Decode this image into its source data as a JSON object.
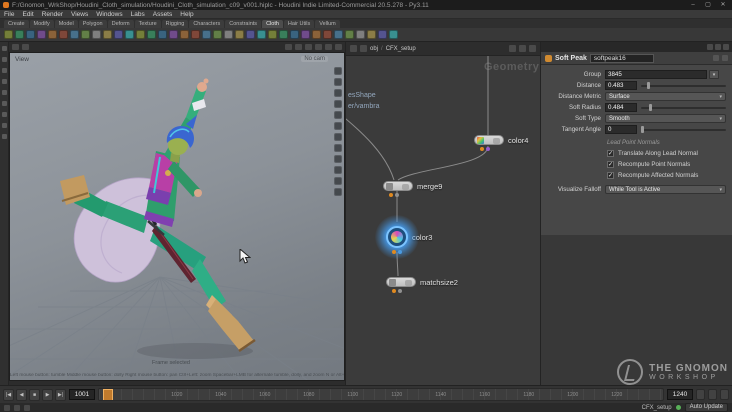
{
  "window": {
    "title": "F:/Gnomon_WrkShop/Houdini_Cloth_simulation/Houdini_Cloth_simulation_c09_v001.hiplc - Houdini Indie Limited-Commercial 20.5.278 - Py3.11",
    "minimize": "–",
    "maximize": "▢",
    "close": "✕"
  },
  "menubar": {
    "items": [
      "File",
      "Edit",
      "Render",
      "Views",
      "Windows",
      "Labs",
      "Assets",
      "Help"
    ]
  },
  "shelf": {
    "tabs": [
      "Create",
      "Modify",
      "Model",
      "Polygon",
      "Deform",
      "Texture",
      "Rigging",
      "Characters",
      "Constraints",
      "Cloth",
      "Hair Utils",
      "Vellum"
    ]
  },
  "viewport": {
    "view_label": "View",
    "camera_label": "No cam",
    "frame_hint": "Frame selected",
    "nav_help": "Left mouse button: tumble   Middle mouse button: dolly   Right mouse button: pan   Ctrl+Left: zoom   Spacebar+LMB for alternate tumble, dolly, and zoom   N or Alt+M for First Person Navigation"
  },
  "network": {
    "path_root": "obj",
    "path_current": "CFX_setup",
    "context_label": "Geometry",
    "clipped_label_1": "esShape",
    "clipped_label_2": "er/vambra",
    "nodes": {
      "n1": "color4",
      "n2": "merge9",
      "n3": "color3",
      "n4": "matchsize2"
    }
  },
  "params": {
    "node_type": "Soft Peak",
    "node_name": "softpeak16",
    "check_glyph": "✓",
    "rows": [
      {
        "label": "Group",
        "value": "3845"
      },
      {
        "label": "Distance",
        "value": "0.483"
      },
      {
        "label": "Distance Metric",
        "value": "Surface"
      },
      {
        "label": "Soft Radius",
        "value": "0.484"
      },
      {
        "label": "Soft Type",
        "value": "Smooth"
      },
      {
        "label": "Tangent Angle",
        "value": "0"
      },
      {
        "label": "Lead Point Normals"
      },
      {
        "label": "Translate Along Lead Normal"
      },
      {
        "label": "Recompute Point Normals"
      },
      {
        "label": "Recompute Affected Normals"
      },
      {
        "label": "Visualize Falloff",
        "value": "While Tool is Active"
      }
    ]
  },
  "timeline": {
    "transport": [
      "|◀",
      "◀",
      "■",
      "▶",
      "▶|"
    ],
    "current_frame": "1001",
    "end_frame": "1240",
    "tick_labels": [
      "1020",
      "1040",
      "1060",
      "1080",
      "1100",
      "1120",
      "1140",
      "1160",
      "1180",
      "1200",
      "1220"
    ]
  },
  "statusbar": {
    "auto_update": "Auto Update",
    "context": "CFX_setup"
  },
  "watermark": {
    "line1": "THE GNOMON",
    "line2": "WORKSHOP"
  },
  "colors": {
    "accent_orange": "#d8862a",
    "select_blue": "#46a0f5"
  },
  "decor": {
    "shelf_icon_count": 36,
    "shelf_palette": [
      "#7f8c3a",
      "#3a8c62",
      "#3a6b8c",
      "#7a4f9a",
      "#9a6a3a",
      "#8c4a3a",
      "#4a7a9a",
      "#6a8c4a",
      "#8c8c8c",
      "#9a8a4a",
      "#5a5aa0",
      "#3aa0a0"
    ]
  }
}
